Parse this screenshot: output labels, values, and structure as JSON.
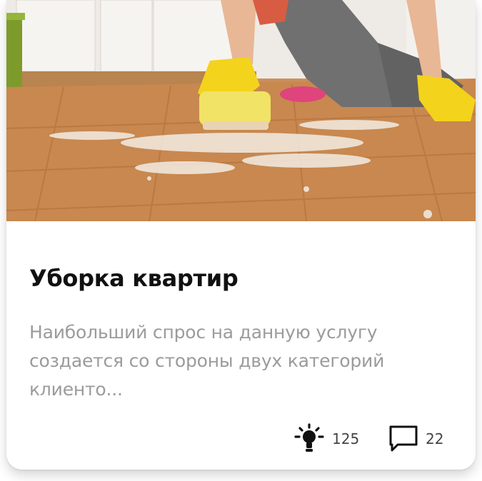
{
  "card": {
    "image_alt": "Уборка квартир",
    "title": "Уборка квартир",
    "description": "Наибольший спрос на данную услугу создается со стороны двух категорий клиенто...",
    "stats": {
      "likes_icon": "lightbulb-icon",
      "likes_count": "125",
      "comments_icon": "speech-bubble-icon",
      "comments_count": "22"
    }
  },
  "colors": {
    "title": "#111111",
    "description": "#9b9b9b",
    "stats": "#444444",
    "icon": "#111111"
  }
}
